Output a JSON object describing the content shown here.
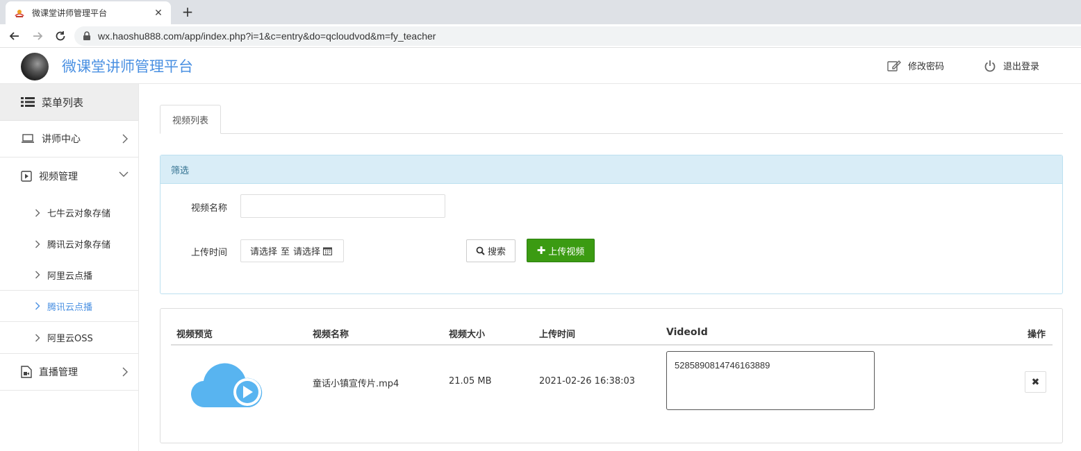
{
  "browser": {
    "tab_title": "微课堂讲师管理平台",
    "url": "wx.haoshu888.com/app/index.php?i=1&c=entry&do=qcloudvod&m=fy_teacher"
  },
  "header": {
    "brand": "微课堂讲师管理平台",
    "change_password": "修改密码",
    "logout": "退出登录",
    "brand_color": "#4a90e2"
  },
  "sidebar": {
    "title": "菜单列表",
    "items": [
      {
        "label": "讲师中心",
        "icon": "laptop-icon"
      },
      {
        "label": "视频管理",
        "icon": "play-square-icon"
      }
    ],
    "video_sub": [
      {
        "label": "七牛云对象存储"
      },
      {
        "label": "腾讯云对象存储"
      },
      {
        "label": "阿里云点播"
      },
      {
        "label": "腾讯云点播"
      },
      {
        "label": "阿里云OSS"
      }
    ],
    "live": {
      "label": "直播管理",
      "icon": "video-file-icon"
    },
    "active_color": "#4a90e2"
  },
  "main": {
    "tab": "视频列表",
    "filter": {
      "title": "筛选",
      "name_label": "视频名称",
      "name_value": "",
      "time_label": "上传时间",
      "date_from": "请选择",
      "date_sep": "至",
      "date_to": "请选择",
      "search_label": "搜索",
      "upload_label": "上传视频",
      "upload_color": "#3b9b12"
    },
    "table": {
      "headers": [
        "视频预览",
        "视频名称",
        "视频大小",
        "上传时间",
        "VideoId",
        "操作"
      ],
      "rows": [
        {
          "name": "童话小镇宣传片.mp4",
          "size": "21.05 MB",
          "time": "2021-02-26 16:38:03",
          "video_id": "5285890814746163889"
        }
      ]
    }
  }
}
